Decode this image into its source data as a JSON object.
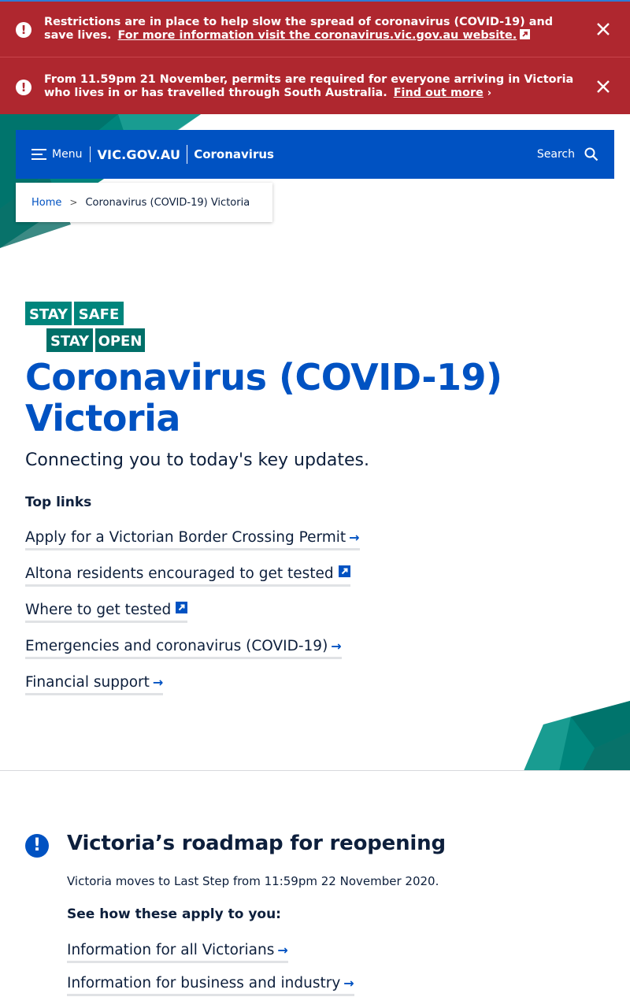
{
  "alerts": [
    {
      "text": "Restrictions are in place to help slow the spread of coronavirus (COVID-19) and save lives.",
      "link": "For more information visit the coronavirus.vic.gov.au website.",
      "link_icon": "external-link-icon",
      "close_icon": "close-icon"
    },
    {
      "text": "From 11.59pm 21 November, permits are required for everyone arriving in Victoria who lives in or has travelled through South Australia.",
      "link": "Find out more",
      "link_icon": "chevron-right-icon",
      "close_icon": "close-icon"
    }
  ],
  "header": {
    "menu_label": "Menu",
    "brand": "VIC.GOV.AU",
    "section": "Coronavirus",
    "search_label": "Search"
  },
  "breadcrumb": {
    "home": "Home",
    "separator": ">",
    "current": "Coronavirus (COVID-19) Victoria"
  },
  "logo": {
    "line1_a": "STAY",
    "line1_b": "SAFE",
    "line2_a": "STAY",
    "line2_b": "OPEN"
  },
  "page": {
    "title": "Coronavirus (COVID-19) Victoria",
    "subtitle": "Connecting you to today's key updates.",
    "top_links_heading": "Top links"
  },
  "top_links": [
    {
      "label": "Apply for a Victorian Border Crossing Permit",
      "icon": "arrow-right-icon"
    },
    {
      "label": "Altona residents encouraged to get tested",
      "icon": "external-link-icon"
    },
    {
      "label": "Where to get tested",
      "icon": "external-link-icon"
    },
    {
      "label": "Emergencies and coronavirus (COVID-19)",
      "icon": "arrow-right-icon"
    },
    {
      "label": "Financial support",
      "icon": "arrow-right-icon"
    }
  ],
  "roadmap": {
    "title": "Victoria’s roadmap for reopening",
    "text": "Victoria moves to Last Step from 11:59pm 22 November 2020.",
    "subheading": "See how these apply to you:",
    "links": [
      {
        "label": "Information for all Victorians",
        "icon": "arrow-right-icon"
      },
      {
        "label": "Information for business and industry",
        "icon": "arrow-right-icon"
      }
    ]
  },
  "colors": {
    "alert_red": "#af272f",
    "primary_blue": "#0052c2",
    "teal": "#00857c",
    "dark_navy": "#0d1f3c"
  }
}
